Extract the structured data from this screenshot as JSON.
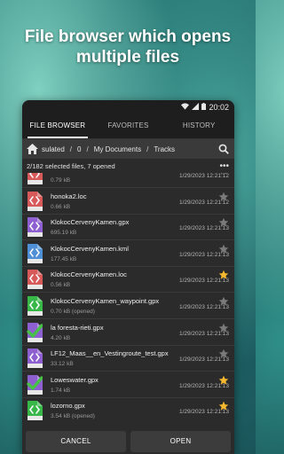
{
  "headline": {
    "line1": "File browser which opens",
    "line2": "multiple files"
  },
  "statusbar": {
    "time": "20:02"
  },
  "tabs": [
    {
      "label": "FILE BROWSER",
      "active": true
    },
    {
      "label": "FAVORITES",
      "active": false
    },
    {
      "label": "HISTORY",
      "active": false
    }
  ],
  "path": {
    "segments": [
      "sulated",
      "0",
      "My Documents",
      "Tracks"
    ],
    "separator": "/"
  },
  "info": {
    "selected": "2/182 selected files, 7 opened"
  },
  "colors": {
    "red_file": "#d65a5a",
    "blue_file": "#4f8fd6",
    "purple_file": "#8d5fd0",
    "green_file": "#39b84a",
    "check": "#46c246",
    "star_on": "#f5b82e",
    "star_off": "#7a7a7a"
  },
  "files": [
    {
      "name": "",
      "size": "0.79 kB",
      "date": "1/29/2023 12:21:12",
      "color": "red",
      "checked": false,
      "starred": false
    },
    {
      "name": "honoka2.loc",
      "size": "0.66 kB",
      "date": "1/29/2023 12:21:12",
      "color": "red",
      "checked": false,
      "starred": false
    },
    {
      "name": "KlokocCervenyKamen.gpx",
      "size": "695.19 kB",
      "date": "1/29/2023 12:21:13",
      "color": "purple",
      "checked": false,
      "starred": false
    },
    {
      "name": "KlokocCervenyKamen.kml",
      "size": "177.45 kB",
      "date": "1/29/2023 12:21:13",
      "color": "blue",
      "checked": false,
      "starred": false
    },
    {
      "name": "KlokocCervenyKamen.loc",
      "size": "0.56 kB",
      "date": "1/29/2023 12:21:13",
      "color": "red",
      "checked": false,
      "starred": true
    },
    {
      "name": "KlokocCervenyKamen_waypoint.gpx",
      "size": "0.70 kB (opened)",
      "date": "1/29/2023 12:21:13",
      "color": "green",
      "checked": false,
      "starred": false
    },
    {
      "name": "la foresta-rieti.gpx",
      "size": "4.20 kB",
      "date": "1/29/2023 12:21:13",
      "color": "purple",
      "checked": true,
      "starred": false
    },
    {
      "name": "LF12_Maas__en_Vestingroute_test.gpx",
      "size": "33.12 kB",
      "date": "1/29/2023 12:21:13",
      "color": "purple",
      "checked": false,
      "starred": false
    },
    {
      "name": "Loweswater.gpx",
      "size": "1.74 kB",
      "date": "1/29/2023 12:21:13",
      "color": "purple",
      "checked": true,
      "starred": true
    },
    {
      "name": "lozorno.gpx",
      "size": "3.54 kB (opened)",
      "date": "1/29/2023 12:21:13",
      "color": "green",
      "checked": false,
      "starred": true
    }
  ],
  "buttons": {
    "cancel": "CANCEL",
    "open": "OPEN"
  }
}
